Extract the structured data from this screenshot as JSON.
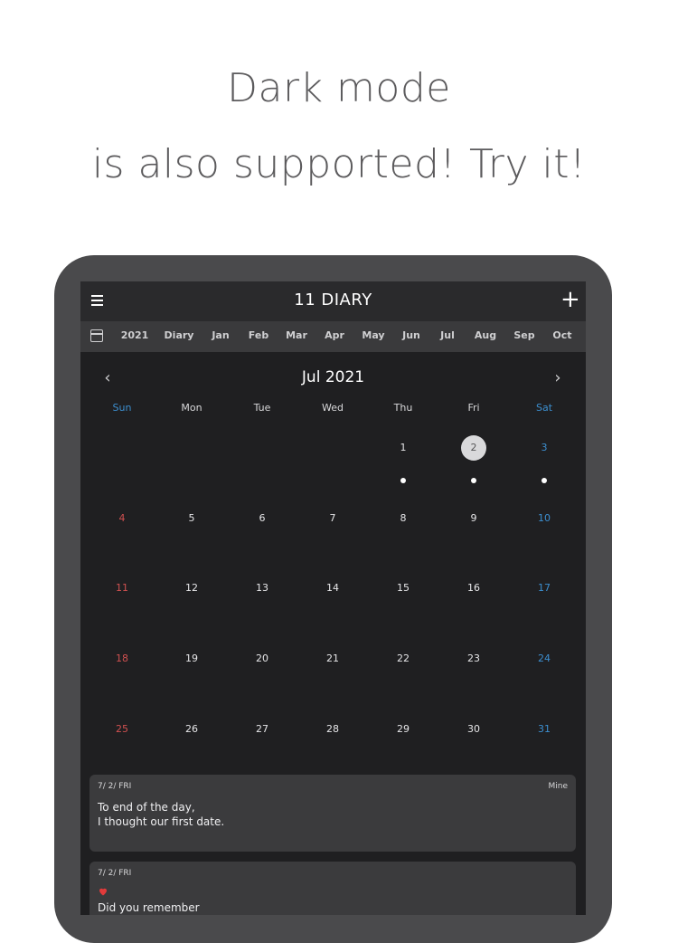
{
  "promo": {
    "line1": "Dark mode",
    "line2": "is also supported! Try it!"
  },
  "app": {
    "title": "11 DIARY",
    "menu_icon": "hamburger-menu-icon",
    "add_icon": "plus-icon",
    "colors": {
      "background": "#1f1f21",
      "header": "#2a2a2c",
      "strip": "#3a3a3c",
      "card": "#3b3b3d",
      "sunday": "#d05050",
      "saturday": "#3c8fd0"
    }
  },
  "strip": {
    "icon": "calendar-icon",
    "items": [
      "2021",
      "Diary",
      "Jan",
      "Feb",
      "Mar",
      "Apr",
      "May",
      "Jun",
      "Jul",
      "Aug",
      "Sep",
      "Oct"
    ]
  },
  "calendar": {
    "title": "Jul 2021",
    "prev_icon": "chevron-left-icon",
    "next_icon": "chevron-right-icon",
    "weekdays": [
      "Sun",
      "Mon",
      "Tue",
      "Wed",
      "Thu",
      "Fri",
      "Sat"
    ],
    "weeks": [
      [
        "",
        "",
        "",
        "",
        "1",
        "2",
        "3"
      ],
      [
        "4",
        "5",
        "6",
        "7",
        "8",
        "9",
        "10"
      ],
      [
        "11",
        "12",
        "13",
        "14",
        "15",
        "16",
        "17"
      ],
      [
        "18",
        "19",
        "20",
        "21",
        "22",
        "23",
        "24"
      ],
      [
        "25",
        "26",
        "27",
        "28",
        "29",
        "30",
        "31"
      ]
    ],
    "selected_day": "2",
    "days_with_entries": [
      "1",
      "2",
      "3"
    ]
  },
  "entries": [
    {
      "date": "7/ 2/ FRI",
      "tag": "Mine",
      "lines": [
        "To end of the day,",
        "I thought our first date."
      ]
    },
    {
      "date": "7/ 2/ FRI",
      "icon": "heart-icon",
      "lines": [
        "Did you remember"
      ]
    }
  ]
}
